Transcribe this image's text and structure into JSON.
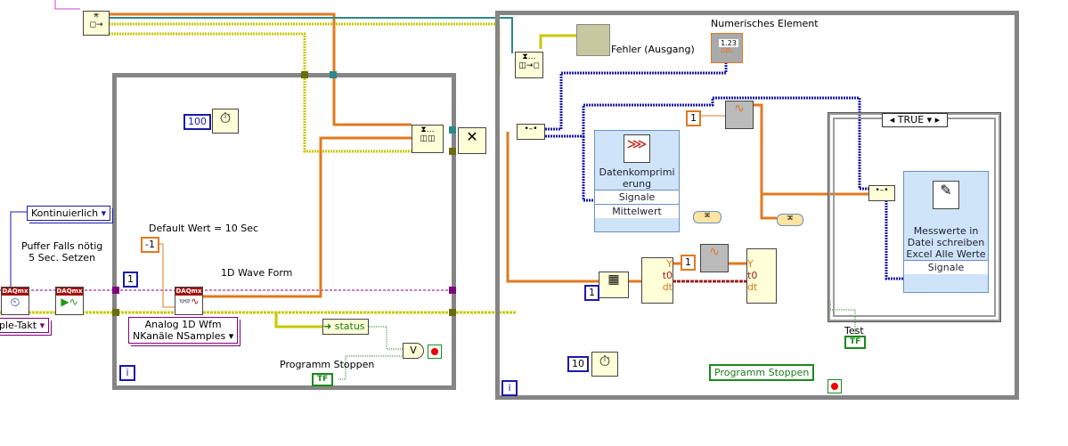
{
  "labels": {
    "continuous": "Kontinuierlich",
    "buffer_note_1": "Puffer Falls nötig",
    "buffer_note_2": "5 Sec.  Setzen",
    "sample_clock": "ple-Takt",
    "default_value": "Default Wert = 10 Sec",
    "wave_form": "1D Wave Form",
    "read_mode_1": "Analog 1D Wfm",
    "read_mode_2": "NKanäle NSamples",
    "status": "status",
    "stop_left": "Programm Stoppen",
    "error_out": "Fehler (Ausgang)",
    "numeric_element": "Numerisches Element",
    "numeric_value": "1.23",
    "numeric_type": "DBL",
    "case_selector": "TRUE",
    "compress_title": "Datenkomprimierung",
    "compress_title_1": "Datenkomprimi",
    "compress_title_2": "erung",
    "compress_in": "Signale",
    "compress_out": "Mittelwert",
    "write_title_1": "Messwerte in",
    "write_title_2": "Datei schreiben",
    "write_title_3": "Excel Alle Werte",
    "write_in": "Signale",
    "test": "Test",
    "stop_right": "Programm Stoppen",
    "bool_tf": "TF",
    "y": "Y",
    "t0": "t0",
    "dt": "dt",
    "iteration": "i"
  },
  "constants": {
    "wait_ms": "100",
    "samples": "-1",
    "index_left": "1",
    "gain_top": "1",
    "gain_bottom": "1",
    "index_right": "1",
    "wait_right": "10"
  },
  "colors": {
    "error_wire": "#c8c800",
    "waveform_wire": "#e07a20",
    "task_wire": "#800080",
    "numeric_wire": "#1a1aa8",
    "boolean": "#1b8a1b",
    "loop_frame": "#858585"
  }
}
